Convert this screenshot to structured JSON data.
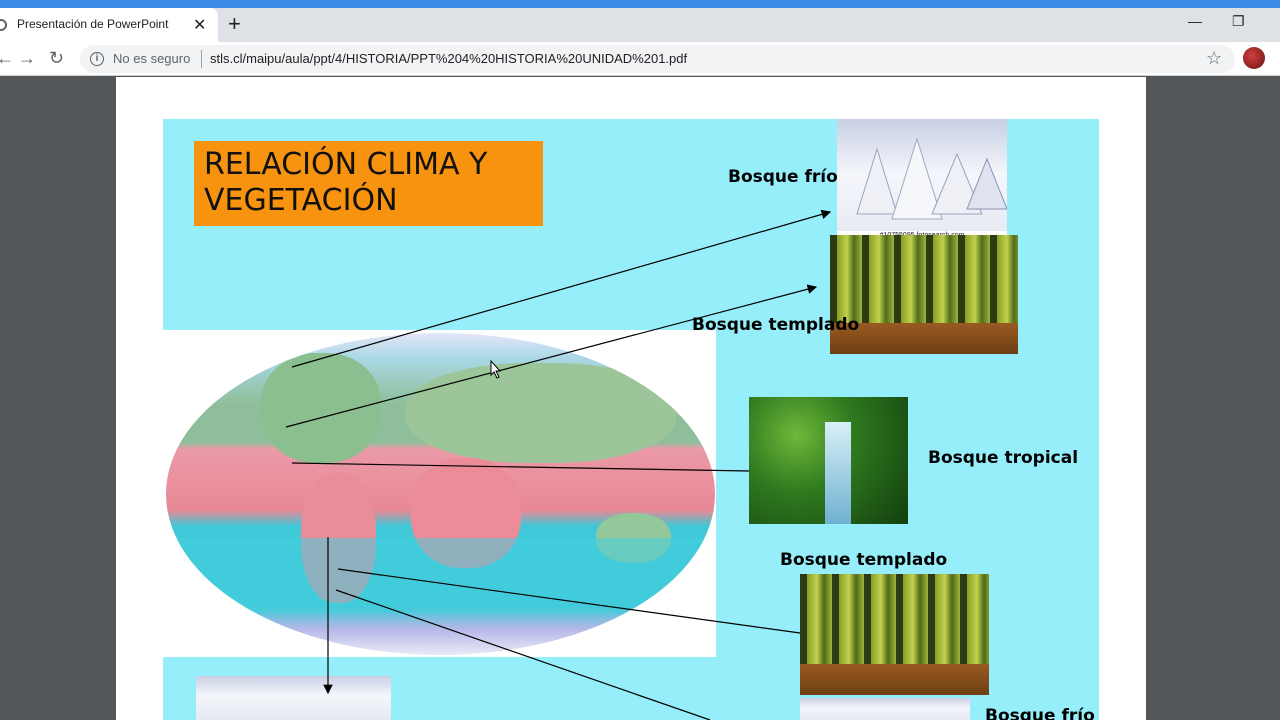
{
  "browser": {
    "tab_title": "Presentación de PowerPoint",
    "tab_close": "✕",
    "new_tab": "+",
    "window_controls": {
      "minimize": "—",
      "restore": "❐",
      "close": "✕"
    },
    "security_label": "No es seguro",
    "url": "stls.cl/maipu/aula/ppt/4/HISTORIA/PPT%204%20HISTORIA%20UNIDAD%201.pdf",
    "icons": [
      "tab-globe-icon",
      "back-arrow-icon",
      "forward-arrow-icon",
      "reload-icon",
      "info-icon",
      "star-icon",
      "avatar"
    ]
  },
  "slide": {
    "title": "RELACIÓN CLIMA  Y\nVEGETACIÓN",
    "labels": {
      "bosque_frio_top": "Bosque frío",
      "bosque_templado_top": "Bosque templado",
      "bosque_tropical": "Bosque tropical",
      "bosque_templado_bottom": "Bosque templado",
      "bosque_frio_bottom": "Bosque frío"
    },
    "photo_caption": "#10755095 fotosearch.com",
    "colors": {
      "slide_background": "#96eefa",
      "title_box": "#f7930e"
    }
  }
}
